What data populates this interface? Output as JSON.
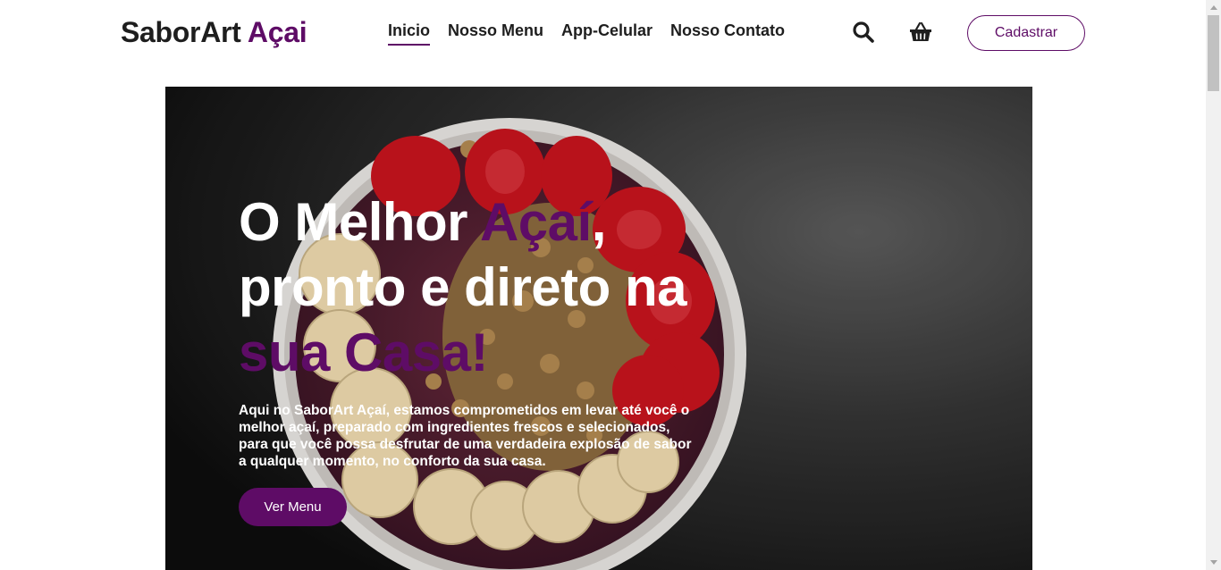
{
  "header": {
    "logo": {
      "part1": "SaborArt",
      "part2": "Açai"
    },
    "nav": [
      {
        "label": "Inicio",
        "active": true
      },
      {
        "label": "Nosso Menu",
        "active": false
      },
      {
        "label": "App-Celular",
        "active": false
      },
      {
        "label": "Nosso Contato",
        "active": false
      }
    ],
    "search_icon": "search-icon",
    "cart_icon": "basket-icon",
    "signup_label": "Cadastrar"
  },
  "hero": {
    "title_line1_a": "O Melhor ",
    "title_line1_b": "Açaí",
    "title_line1_c": ",",
    "title_line2": "pronto e direto na",
    "title_line3": "sua Casa!",
    "description": "Aqui no SaborArt Açaí, estamos comprometidos em levar até você o melhor açaí, preparado com ingredientes frescos e selecionados, para que você possa desfrutar de uma verdadeira explosão de sabor a qualquer momento, no conforto da sua casa.",
    "cta_label": "Ver Menu"
  },
  "colors": {
    "accent": "#5e0c66",
    "text": "#1e1e1e",
    "hero_bg": "#2a2a2a"
  }
}
